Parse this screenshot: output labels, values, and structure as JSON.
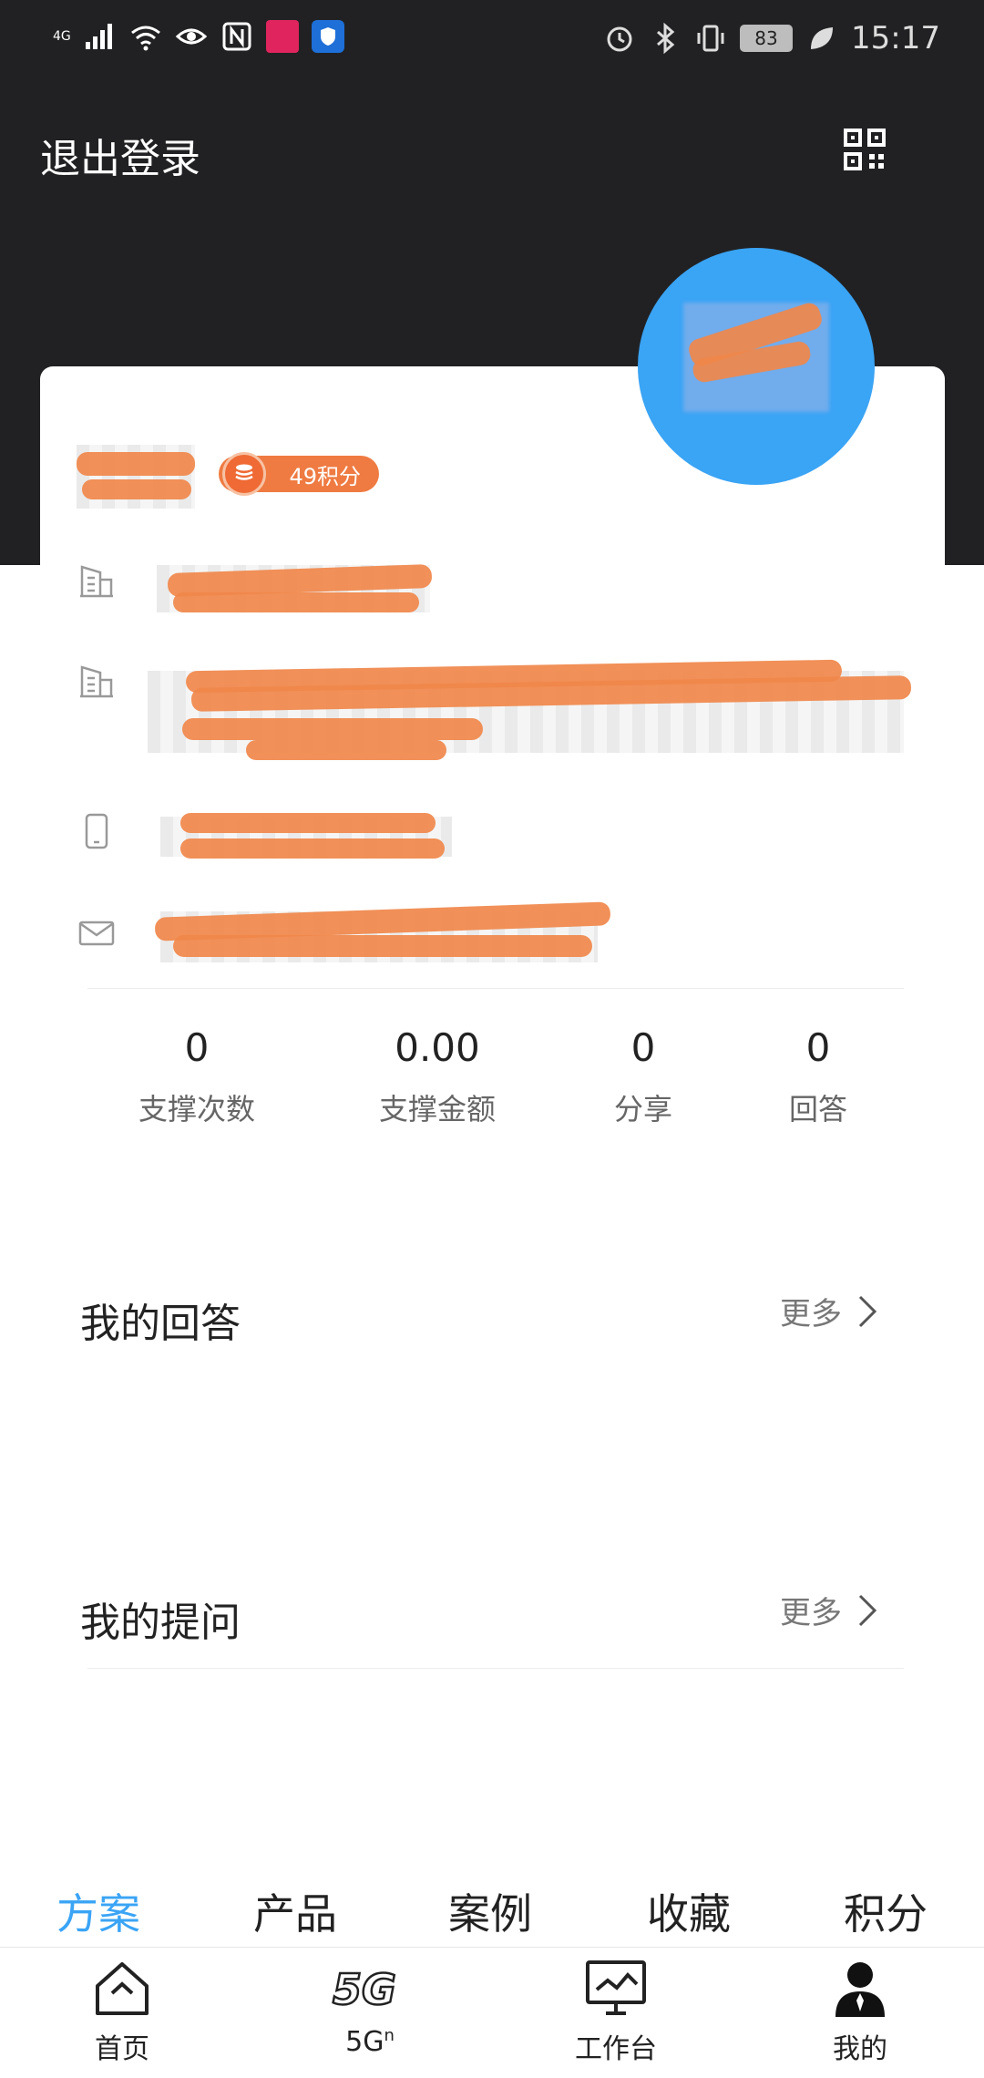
{
  "status_bar": {
    "network": "4G",
    "battery": "83",
    "time": "15:17"
  },
  "header": {
    "logout_label": "退出登录",
    "qr_icon": "qr-code-icon"
  },
  "profile": {
    "points_badge": "49积分",
    "info_icons": [
      "building-icon",
      "building-icon",
      "phone-icon",
      "mail-icon"
    ]
  },
  "stats": [
    {
      "value": "0",
      "label": "支撑次数"
    },
    {
      "value": "0.00",
      "label": "支撑金额"
    },
    {
      "value": "0",
      "label": "分享"
    },
    {
      "value": "0",
      "label": "回答"
    }
  ],
  "sections": {
    "answers_title": "我的回答",
    "questions_title": "我的提问",
    "more_label": "更多"
  },
  "tabs": [
    "方案",
    "产品",
    "案例",
    "收藏",
    "积分"
  ],
  "active_tab": "方案",
  "nav": {
    "home": "首页",
    "fiveg": "5G",
    "fiveg_sup": "n",
    "workbench": "工作台",
    "mine": "我的"
  },
  "colors": {
    "header_bg": "#212123",
    "accent": "#3aa4f5",
    "badge": "#ef7b42"
  }
}
